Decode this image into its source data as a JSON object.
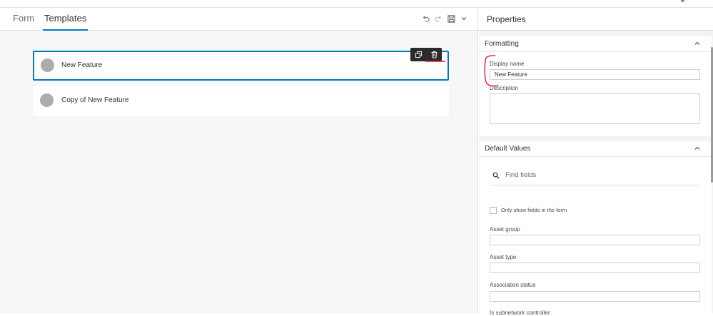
{
  "tabs": [
    {
      "label": "Form",
      "active": false
    },
    {
      "label": "Templates",
      "active": true
    }
  ],
  "toolbar": {
    "icons": [
      "undo-icon",
      "redo-icon",
      "save-icon",
      "chevron-down-icon"
    ]
  },
  "templates": [
    {
      "label": "New Feature",
      "selected": true
    },
    {
      "label": "Copy of New Feature",
      "selected": false
    }
  ],
  "card_actions": [
    "duplicate-icon",
    "trash-icon"
  ],
  "properties": {
    "title": "Properties",
    "formatting": {
      "title": "Formatting",
      "display_name_label": "Display name",
      "display_name_value": "New Feature",
      "description_label": "Description",
      "description_value": ""
    },
    "default_values": {
      "title": "Default Values",
      "search_placeholder": "Find fields",
      "only_show_label": "Only show fields in the form",
      "only_show_checked": false,
      "fields": [
        {
          "label": "Asset group",
          "value": ""
        },
        {
          "label": "Asset type",
          "value": ""
        },
        {
          "label": "Association status",
          "value": ""
        },
        {
          "label": "Is subnetwork controller",
          "value": ""
        }
      ]
    }
  },
  "colors": {
    "accent": "#007ac2",
    "annotation": "#e0182d",
    "avatar": "#acacac"
  }
}
